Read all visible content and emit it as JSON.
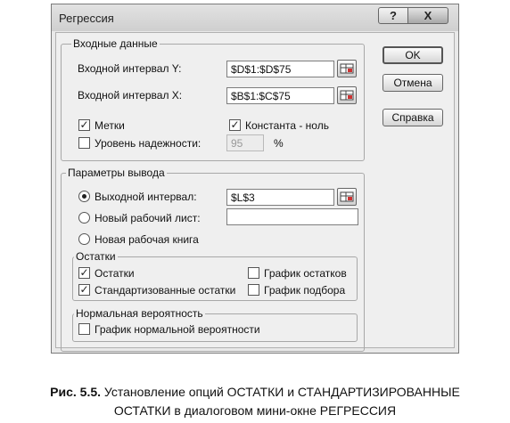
{
  "dialog": {
    "title": "Регрессия",
    "help_glyph": "?",
    "close_glyph": "X"
  },
  "input_group": {
    "label": "Входные данные",
    "y_label": "Входной интервал Y:",
    "y_value": "$D$1:$D$75",
    "x_label": "Входной интервал X:",
    "x_value": "$B$1:$C$75",
    "labels_checkbox": {
      "label": "Метки",
      "checked": true
    },
    "constant_zero_checkbox": {
      "label": "Константа - ноль",
      "checked": true
    },
    "confidence_checkbox": {
      "label": "Уровень надежности:",
      "checked": false
    },
    "confidence_value": "95",
    "confidence_unit": "%"
  },
  "output_group": {
    "label": "Параметры вывода",
    "output_range_radio": {
      "label": "Выходной интервал:",
      "selected": true
    },
    "output_range_value": "$L$3",
    "new_sheet_radio": {
      "label": "Новый рабочий лист:",
      "selected": false
    },
    "new_sheet_value": "",
    "new_book_radio": {
      "label": "Новая рабочая книга",
      "selected": false
    }
  },
  "residuals_group": {
    "label": "Остатки",
    "residuals": {
      "label": "Остатки",
      "checked": true
    },
    "standardized_residuals": {
      "label": "Стандартизованные остатки",
      "checked": true
    },
    "residual_plots": {
      "label": "График остатков",
      "checked": false
    },
    "line_fit_plots": {
      "label": "График подбора",
      "checked": false
    }
  },
  "normal_group": {
    "label": "Нормальная вероятность",
    "normal_plot": {
      "label": "График нормальной вероятности",
      "checked": false
    }
  },
  "buttons": {
    "ok": "OK",
    "cancel": "Отмена",
    "help": "Справка"
  },
  "caption": {
    "prefix": "Рис. 5.5.",
    "line1": " Установление опций ОСТАТКИ и СТАНДАРТИЗИРОВАННЫЕ",
    "line2": "ОСТАТКИ в диалоговом мини-окне РЕГРЕССИЯ"
  }
}
